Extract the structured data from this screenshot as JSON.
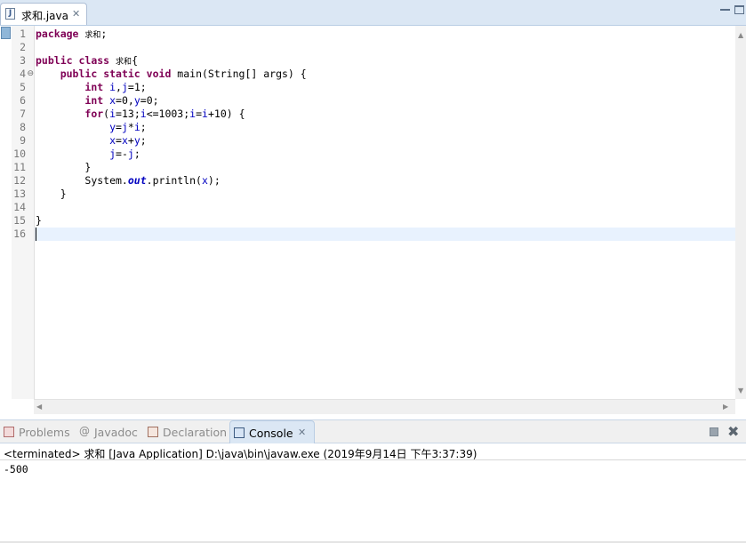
{
  "editor": {
    "tab": {
      "label": "求和.java",
      "close": "✕"
    },
    "lines": [
      {
        "n": "1",
        "fold": "",
        "indent": "",
        "tokens": [
          {
            "t": "kw",
            "v": "package"
          },
          {
            "t": "txt",
            "v": " "
          },
          {
            "t": "cjk",
            "v": "求和"
          },
          {
            "t": "txt",
            "v": ";"
          }
        ]
      },
      {
        "n": "2",
        "fold": "",
        "indent": "",
        "tokens": []
      },
      {
        "n": "3",
        "fold": "",
        "indent": "",
        "tokens": [
          {
            "t": "kw",
            "v": "public"
          },
          {
            "t": "txt",
            "v": " "
          },
          {
            "t": "kw",
            "v": "class"
          },
          {
            "t": "txt",
            "v": " "
          },
          {
            "t": "cjk",
            "v": "求和"
          },
          {
            "t": "txt",
            "v": "{"
          }
        ]
      },
      {
        "n": "4",
        "fold": "⊖",
        "indent": "    ",
        "tokens": [
          {
            "t": "kw",
            "v": "public"
          },
          {
            "t": "txt",
            "v": " "
          },
          {
            "t": "kw",
            "v": "static"
          },
          {
            "t": "txt",
            "v": " "
          },
          {
            "t": "kw",
            "v": "void"
          },
          {
            "t": "txt",
            "v": " main(String[] args) {"
          }
        ]
      },
      {
        "n": "5",
        "fold": "",
        "indent": "        ",
        "tokens": [
          {
            "t": "kw",
            "v": "int"
          },
          {
            "t": "txt",
            "v": " "
          },
          {
            "t": "var",
            "v": "i"
          },
          {
            "t": "txt",
            "v": ","
          },
          {
            "t": "var",
            "v": "j"
          },
          {
            "t": "txt",
            "v": "=1;"
          }
        ]
      },
      {
        "n": "6",
        "fold": "",
        "indent": "        ",
        "tokens": [
          {
            "t": "kw",
            "v": "int"
          },
          {
            "t": "txt",
            "v": " "
          },
          {
            "t": "var",
            "v": "x"
          },
          {
            "t": "txt",
            "v": "=0,"
          },
          {
            "t": "var",
            "v": "y"
          },
          {
            "t": "txt",
            "v": "=0;"
          }
        ]
      },
      {
        "n": "7",
        "fold": "",
        "indent": "        ",
        "tokens": [
          {
            "t": "kw",
            "v": "for"
          },
          {
            "t": "txt",
            "v": "("
          },
          {
            "t": "var",
            "v": "i"
          },
          {
            "t": "txt",
            "v": "=13;"
          },
          {
            "t": "var",
            "v": "i"
          },
          {
            "t": "txt",
            "v": "<=1003;"
          },
          {
            "t": "var",
            "v": "i"
          },
          {
            "t": "txt",
            "v": "="
          },
          {
            "t": "var",
            "v": "i"
          },
          {
            "t": "txt",
            "v": "+10) {"
          }
        ]
      },
      {
        "n": "8",
        "fold": "",
        "indent": "            ",
        "tokens": [
          {
            "t": "var",
            "v": "y"
          },
          {
            "t": "txt",
            "v": "="
          },
          {
            "t": "var",
            "v": "j"
          },
          {
            "t": "txt",
            "v": "*"
          },
          {
            "t": "var",
            "v": "i"
          },
          {
            "t": "txt",
            "v": ";"
          }
        ]
      },
      {
        "n": "9",
        "fold": "",
        "indent": "            ",
        "tokens": [
          {
            "t": "var",
            "v": "x"
          },
          {
            "t": "txt",
            "v": "="
          },
          {
            "t": "var",
            "v": "x"
          },
          {
            "t": "txt",
            "v": "+"
          },
          {
            "t": "var",
            "v": "y"
          },
          {
            "t": "txt",
            "v": ";"
          }
        ]
      },
      {
        "n": "10",
        "fold": "",
        "indent": "            ",
        "tokens": [
          {
            "t": "var",
            "v": "j"
          },
          {
            "t": "txt",
            "v": "=-"
          },
          {
            "t": "var",
            "v": "j"
          },
          {
            "t": "txt",
            "v": ";"
          }
        ]
      },
      {
        "n": "11",
        "fold": "",
        "indent": "        ",
        "tokens": [
          {
            "t": "txt",
            "v": "}"
          }
        ]
      },
      {
        "n": "12",
        "fold": "",
        "indent": "        ",
        "tokens": [
          {
            "t": "txt",
            "v": "System."
          },
          {
            "t": "field",
            "v": "out"
          },
          {
            "t": "txt",
            "v": ".println("
          },
          {
            "t": "var",
            "v": "x"
          },
          {
            "t": "txt",
            "v": ");"
          }
        ]
      },
      {
        "n": "13",
        "fold": "",
        "indent": "    ",
        "tokens": [
          {
            "t": "txt",
            "v": "}"
          }
        ]
      },
      {
        "n": "14",
        "fold": "",
        "indent": "",
        "tokens": []
      },
      {
        "n": "15",
        "fold": "",
        "indent": "",
        "tokens": [
          {
            "t": "txt",
            "v": "}"
          }
        ]
      },
      {
        "n": "16",
        "fold": "",
        "indent": "",
        "tokens": []
      }
    ],
    "current_line": 16,
    "colors": {
      "keyword": "#7f0055",
      "variable": "#0000c0",
      "current_line": "#e8f2fe"
    }
  },
  "panel": {
    "tabs": [
      {
        "label": "Problems",
        "icon": "problems-icon",
        "active": false
      },
      {
        "label": "Javadoc",
        "icon": "javadoc-icon",
        "active": false
      },
      {
        "label": "Declaration",
        "icon": "declaration-icon",
        "active": false
      },
      {
        "label": "Console",
        "icon": "console-icon",
        "active": true
      }
    ],
    "console_close": "✕",
    "console_header": "<terminated> 求和 [Java Application] D:\\java\\bin\\javaw.exe (2019年9月14日 下午3:37:39)",
    "console_output": "-500"
  }
}
